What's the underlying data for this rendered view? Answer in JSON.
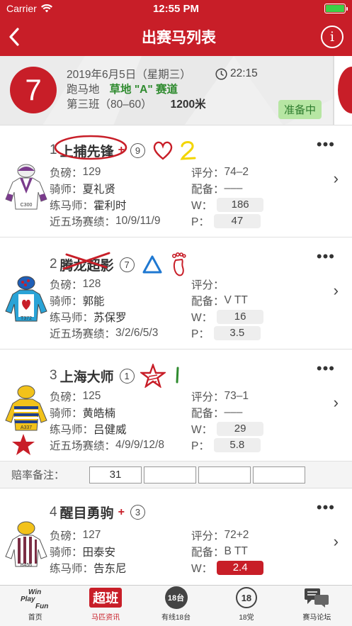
{
  "status": {
    "carrier": "Carrier",
    "time": "12:55 PM"
  },
  "nav": {
    "title": "出赛马列表",
    "info": "i"
  },
  "race": {
    "number": "7",
    "date": "2019年6月5日（星期三）",
    "time": "22:15",
    "venue": "跑马地",
    "course": "草地 \"A\" 赛道",
    "class": "第三班（80–60）",
    "distance": "1200米",
    "status": "准备中"
  },
  "horses": [
    {
      "num": "1",
      "name": "上捕先锋",
      "plus": "+",
      "draw": "9",
      "weight_label": "负磅：",
      "weight": "129",
      "rating_label": "评分：",
      "rating": "74–2",
      "jockey_label": "骑师：",
      "jockey": "夏礼贤",
      "gear_label": "配备：",
      "gear": "–––",
      "trainer_label": "练马师：",
      "trainer": "霍利时",
      "w_label": "W：",
      "w": "186",
      "form_label": "近五场赛绩：",
      "form": "10/9/11/9",
      "p_label": "P：",
      "p": "47",
      "silks_code": "C300"
    },
    {
      "num": "2",
      "name": "腾龙超影",
      "draw": "7",
      "weight_label": "负磅：",
      "weight": "128",
      "rating_label": "评分：",
      "rating": "",
      "jockey_label": "骑师：",
      "jockey": "郭能",
      "gear_label": "配备：",
      "gear": "V TT",
      "trainer_label": "练马师：",
      "trainer": "苏保罗",
      "w_label": "W：",
      "w": "16",
      "form_label": "近五场赛绩：",
      "form": "3/2/6/5/3",
      "p_label": "P：",
      "p": "3.5",
      "silks_code": "T372"
    },
    {
      "num": "3",
      "name": "上海大师",
      "draw": "1",
      "weight_label": "负磅：",
      "weight": "125",
      "rating_label": "评分：",
      "rating": "73–1",
      "jockey_label": "骑师：",
      "jockey": "黄皓楠",
      "gear_label": "配备：",
      "gear": "–––",
      "trainer_label": "练马师：",
      "trainer": "吕健威",
      "w_label": "W：",
      "w": "29",
      "form_label": "近五场赛绩：",
      "form": "4/9/9/12/8",
      "p_label": "P：",
      "p": "5.8",
      "silks_code": "A337"
    },
    {
      "num": "4",
      "name": "醒目勇驹",
      "plus": "+",
      "draw": "3",
      "weight_label": "负磅：",
      "weight": "127",
      "rating_label": "评分：",
      "rating": "72+2",
      "jockey_label": "骑师：",
      "jockey": "田泰安",
      "gear_label": "配备：",
      "gear": "B TT",
      "trainer_label": "练马师：",
      "trainer": "告东尼",
      "w_label": "W：",
      "w": "2.4",
      "silks_code": "B456"
    }
  ],
  "odds_note": {
    "label": "赔率备注：",
    "values": [
      "31",
      "",
      "",
      ""
    ]
  },
  "tabs": [
    {
      "label": "首页",
      "icon": "win-play-fun-icon"
    },
    {
      "label": "马匹资讯",
      "icon": "chao-ban-icon",
      "icon_text": "超班"
    },
    {
      "label": "有线18台",
      "icon": "cable-18-icon",
      "icon_text": "18台"
    },
    {
      "label": "18党",
      "icon": "party-18-icon",
      "icon_text": "18"
    },
    {
      "label": "赛马论坛",
      "icon": "forum-icon"
    }
  ],
  "colors": {
    "brand": "#c81e28",
    "course": "#2f8b2f",
    "ready_bg": "#b7e6a3"
  }
}
